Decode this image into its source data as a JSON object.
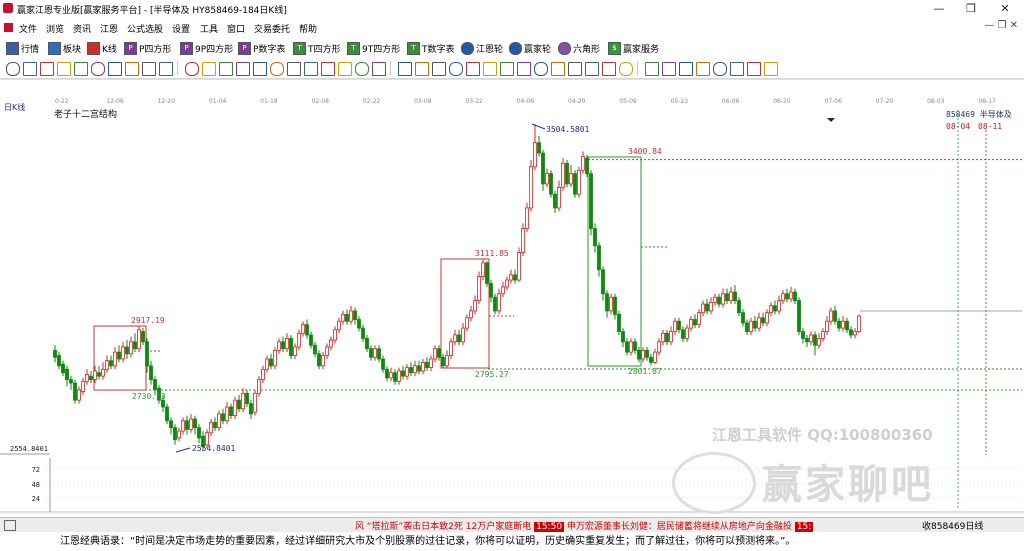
{
  "window": {
    "title": "赢家江恩专业版[赢家服务平台] - [半导体及  HY858469-184日K线]",
    "controls": [
      "—",
      "❐",
      "✕"
    ]
  },
  "menu": [
    "文件",
    "浏览",
    "资讯",
    "江恩",
    "公式选股",
    "设置",
    "工具",
    "窗口",
    "交易委托",
    "帮助"
  ],
  "toolbar1": [
    "行情",
    "板块",
    "K线",
    "P四方形",
    "9P四方形",
    "P数字表",
    "T四方形",
    "9T四方形",
    "T数字表",
    "江恩轮",
    "赢家轮",
    "六角形",
    "赢家服务"
  ],
  "date_axis": [
    "0-22",
    "12-06",
    "12-20",
    "01-04",
    "01-18",
    "02-08",
    "02-22",
    "03-08",
    "03-22",
    "04-06",
    "04-20",
    "05-09",
    "05-23",
    "06-06",
    "06-20",
    "07-06",
    "07-20",
    "08-03",
    "08-17"
  ],
  "chart_data": {
    "type": "candlestick",
    "period": "日K线",
    "indicator": "老子十二宫结构",
    "right_labels": [
      "858469  半导体及",
      "08-04",
      "08-11"
    ],
    "price_labels": [
      {
        "text": "2917.19",
        "value": 2917.19
      },
      {
        "text": "2730.23",
        "value": 2730.23
      },
      {
        "text": "2554.8401",
        "value": 2554.8401
      },
      {
        "text": "3111.85",
        "value": 3111.85
      },
      {
        "text": "2795.27",
        "value": 2795.27
      },
      {
        "text": "3504.5801",
        "value": 3504.5801
      },
      {
        "text": "3400.84",
        "value": 3400.84
      },
      {
        "text": "2801.87",
        "value": 2801.87
      }
    ],
    "y_axis_left": "2554.8401",
    "volume_ticks": [
      "72",
      "48",
      "24"
    ],
    "watermarks": [
      "江恩工具软件  QQ:100800360",
      "赢家聊吧"
    ]
  },
  "statusbar": {
    "ticker_parts": [
      "风 “塔拉斯”袭击日本致2死 12万户家庭断电",
      "15:50",
      "申万宏源董事长刘健：居民储蓄将继续从房地产向金融投",
      "15:"
    ],
    "right_text": "收858469日线"
  },
  "quote": "江恩经典语录：“时间是决定市场走势的重要因素，经过详细研究大市及个别股票的过往记录，你将可以证明，历史确实重复发生；而了解过往，你将可以预测将来。”。"
}
